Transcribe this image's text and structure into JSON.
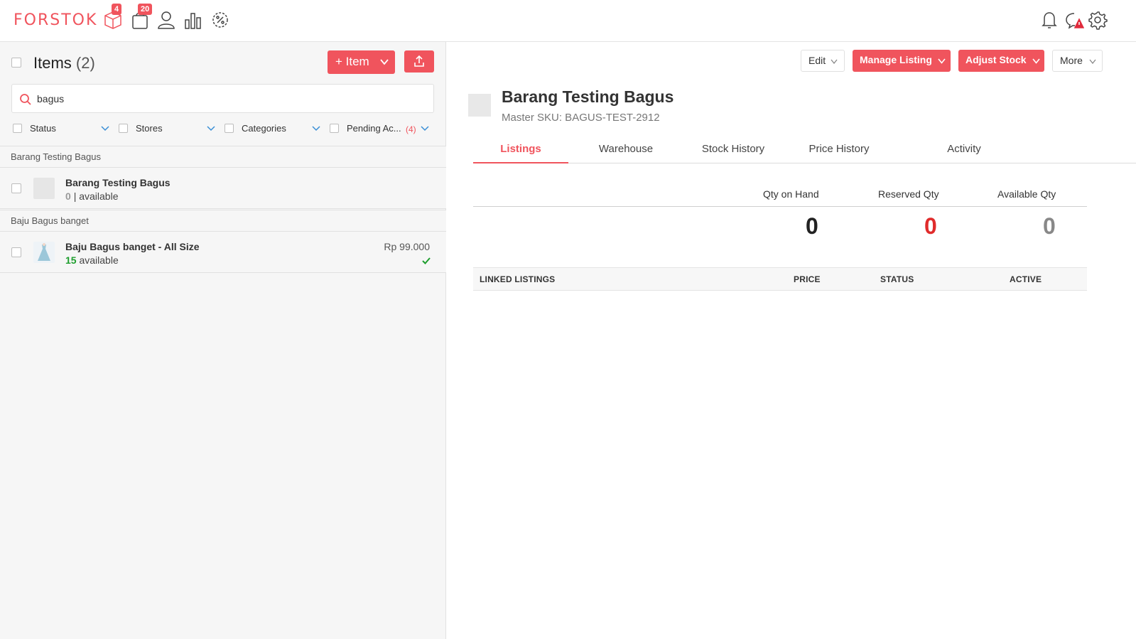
{
  "header": {
    "logo": "FORSTOK",
    "nav": [
      {
        "icon": "box-icon",
        "badge": "4"
      },
      {
        "icon": "shopping-bag-icon",
        "badge": "20"
      },
      {
        "icon": "user-icon",
        "badge": ""
      },
      {
        "icon": "bar-chart-icon",
        "badge": ""
      },
      {
        "icon": "promotion-icon",
        "badge": ""
      }
    ],
    "right_icons": [
      "bell-icon",
      "alert-chat-icon",
      "gear-icon"
    ]
  },
  "left": {
    "title": "Items",
    "count": "(2)",
    "add_button": "+ Item",
    "search_value": "bagus",
    "filters": {
      "status": "Status",
      "stores": "Stores",
      "categories": "Categories",
      "pending": "Pending Ac...",
      "pending_count": "(4)"
    },
    "groups": [
      {
        "header": "Barang Testing Bagus",
        "item": {
          "name": "Barang Testing Bagus",
          "qty": "0",
          "available_label": "| available",
          "price": ""
        }
      },
      {
        "header": "Baju Bagus banget",
        "item": {
          "name": "Baju Bagus banget - All Size",
          "qty": "15",
          "available_label": "available",
          "price": "Rp 99.000",
          "status_icon": "check-icon"
        }
      }
    ]
  },
  "detail": {
    "buttons": {
      "edit": "Edit",
      "manage_listing": "Manage Listing",
      "adjust_stock": "Adjust Stock",
      "more": "More"
    },
    "title": "Barang Testing Bagus",
    "sku": "Master SKU: BAGUS-TEST-2912",
    "tabs": [
      "Listings",
      "Warehouse",
      "Stock History",
      "Price History",
      "Activity"
    ],
    "active_tab": "Listings",
    "qty": {
      "on_hand_label": "Qty on Hand",
      "on_hand": "0",
      "reserved_label": "Reserved Qty",
      "reserved": "0",
      "available_label": "Available Qty",
      "available": "0"
    },
    "linked_listings": {
      "col1": "LINKED LISTINGS",
      "col2": "PRICE",
      "col3": "STATUS",
      "col4": "ACTIVE"
    }
  },
  "colors": {
    "brand": "#f0545d",
    "green": "#1e9e2e",
    "blue_chevron": "#3a8fd6"
  }
}
